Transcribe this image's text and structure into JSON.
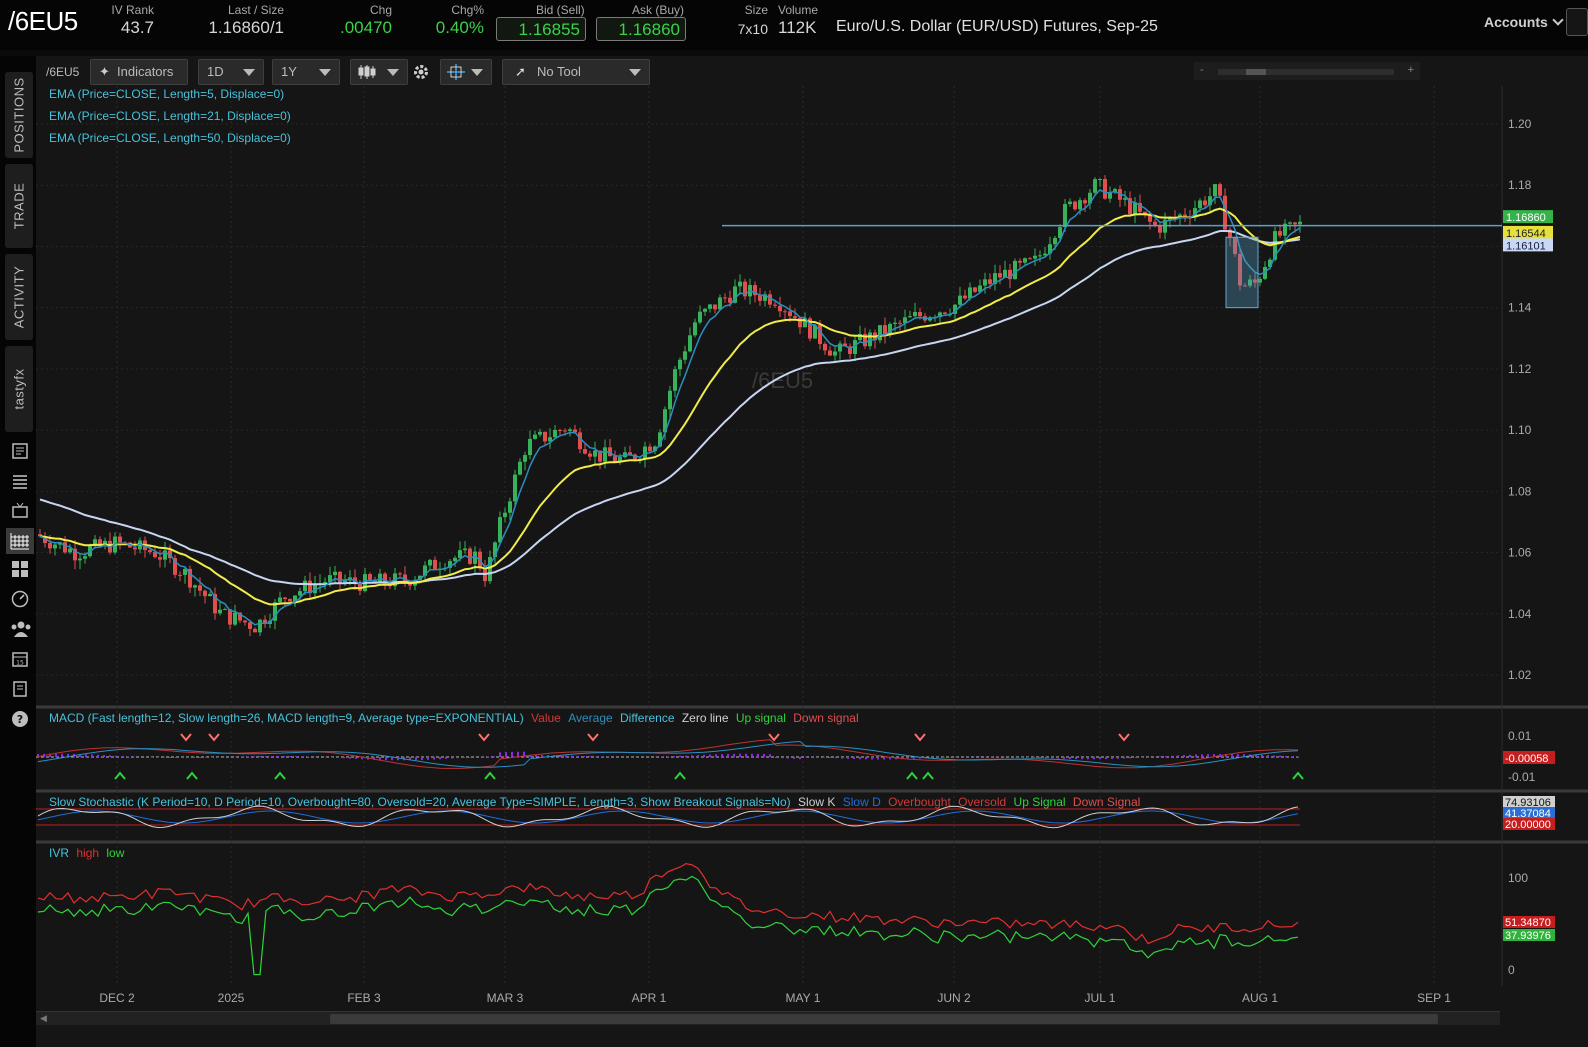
{
  "header": {
    "symbol": "/6EU5",
    "ivrank": {
      "label": "IV Rank",
      "value": "43.7"
    },
    "last": {
      "label": "Last / Size",
      "value": "1.16860",
      "size": "/1"
    },
    "chg": {
      "label": "Chg",
      "value": ".00470"
    },
    "chgpct": {
      "label": "Chg%",
      "value": "0.40%"
    },
    "bid": {
      "label": "Bid (Sell)",
      "value": "1.16855"
    },
    "ask": {
      "label": "Ask (Buy)",
      "value": "1.16860"
    },
    "size": {
      "label": "Size",
      "value": "7x10"
    },
    "volume": {
      "label": "Volume",
      "value": "112K"
    },
    "description": "Euro/U.S. Dollar (EUR/USD) Futures, Sep-25",
    "accounts_label": "Accounts"
  },
  "sidebar": {
    "tabs": [
      "POSITIONS",
      "TRADE",
      "ACTIVITY",
      "tastyfx"
    ],
    "icons": [
      "news-icon",
      "list-icon",
      "tv-icon",
      "chart-icon",
      "grid-icon",
      "dashboard-icon",
      "community-icon",
      "calendar-icon",
      "document-icon",
      "help-icon"
    ]
  },
  "toolbar": {
    "symbol": "/6EU5",
    "indicators": "Indicators",
    "interval": "1D",
    "range": "1Y",
    "tool": "No Tool",
    "zoom_minus": "-",
    "zoom_plus": "+"
  },
  "colors": {
    "ema5": "#2a8fc0",
    "ema21": "#f1ec49",
    "ema50": "#c6d6f2",
    "up": "#36b35a",
    "down": "#e04e4e",
    "hline": "#5aa0c8"
  },
  "price_panel": {
    "studies": [
      "EMA (Price=CLOSE, Length=5, Displace=0)",
      "EMA (Price=CLOSE, Length=21, Displace=0)",
      "EMA (Price=CLOSE, Length=50, Displace=0)"
    ],
    "watermark": "/6EU5",
    "y_ticks": [
      "1.20",
      "1.18",
      "1.16",
      "1.14",
      "1.12",
      "1.10",
      "1.08",
      "1.06",
      "1.04",
      "1.02"
    ],
    "last_labels": [
      {
        "text": "1.16860",
        "bg": "#35b34a",
        "fg": "#ffffff"
      },
      {
        "text": "1.16544",
        "bg": "#e6e03c",
        "fg": "#222222"
      },
      {
        "text": "1.16101",
        "bg": "#c9d8f3",
        "fg": "#1a1a40"
      }
    ]
  },
  "macd_panel": {
    "title": "MACD (Fast length=12, Slow length=26, MACD length=9, Average type=EXPONENTIAL)",
    "legend": [
      {
        "text": "Value",
        "color": "#d13a3a"
      },
      {
        "text": "Average",
        "color": "#2a8fc0"
      },
      {
        "text": "Difference",
        "color": "#45c3dd"
      },
      {
        "text": "Zero line",
        "color": "#d0d0d0"
      },
      {
        "text": "Up signal",
        "color": "#2fd33a"
      },
      {
        "text": "Down signal",
        "color": "#e04e4e"
      }
    ],
    "y_ticks": [
      "0.01",
      "-0.01"
    ],
    "last_label": "-0.00058"
  },
  "stoch_panel": {
    "title": "Slow Stochastic (K Period=10, D Period=10, Overbought=80, Oversold=20, Average Type=SIMPLE, Length=3, Show Breakout Signals=No)",
    "legend": [
      {
        "text": "Slow K",
        "color": "#cfcfcf"
      },
      {
        "text": "Slow D",
        "color": "#1f6fd6"
      },
      {
        "text": "Overbought",
        "color": "#d13a3a"
      },
      {
        "text": "Oversold",
        "color": "#d13a3a"
      },
      {
        "text": "Up Signal",
        "color": "#2fd33a"
      },
      {
        "text": "Down Signal",
        "color": "#e04e4e"
      }
    ],
    "last_labels": [
      "74.93106",
      "41.37084",
      "20.00000"
    ]
  },
  "ivr_panel": {
    "title": "IVR",
    "legend": [
      {
        "text": "high",
        "color": "#e03030"
      },
      {
        "text": "low",
        "color": "#2fd33a"
      }
    ],
    "y_ticks": [
      "100",
      "0"
    ],
    "last_labels": [
      "51.34870",
      "37.93976"
    ]
  },
  "x_axis": [
    "DEC 2",
    "2025",
    "FEB 3",
    "MAR 3",
    "APR 1",
    "MAY 1",
    "JUN 2",
    "JUL 1",
    "AUG 1",
    "SEP 1"
  ]
}
